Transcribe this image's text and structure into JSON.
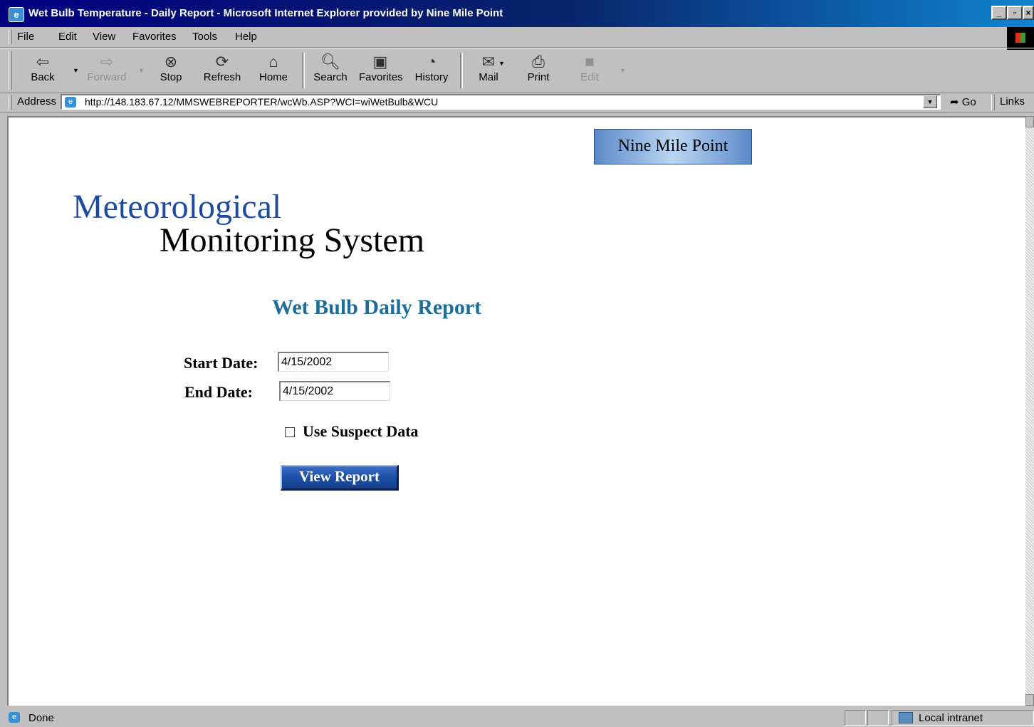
{
  "window": {
    "title": "Wet Bulb Temperature - Daily Report - Microsoft Internet Explorer provided by Nine Mile Point"
  },
  "menu": [
    "File",
    "Edit",
    "View",
    "Favorites",
    "Tools",
    "Help"
  ],
  "toolbar": {
    "back": "Back",
    "forward": "Forward",
    "stop": "Stop",
    "refresh": "Refresh",
    "home": "Home",
    "search": "Search",
    "favorites": "Favorites",
    "history": "History",
    "mail": "Mail",
    "print": "Print",
    "edit": "Edit"
  },
  "address": {
    "label": "Address",
    "url": "http://148.183.67.12/MMSWEBREPORTER/wcWb.ASP?WCI=wiWetBulb&WCU",
    "go": "Go",
    "links": "Links"
  },
  "page": {
    "site_button": "Nine Mile Point",
    "logo_line1": "Meteorological",
    "logo_line2": "Monitoring System",
    "report_title": "Wet Bulb Daily Report",
    "start_label": "Start Date:",
    "start_value": "4/15/2002",
    "end_label": "End Date:",
    "end_value": "4/15/2002",
    "suspect_label": "Use Suspect Data",
    "suspect_checked": false,
    "view_button": "View Report"
  },
  "status": {
    "text": "Done",
    "zone": "Local intranet"
  },
  "colors": {
    "title_bar": "#000080",
    "logo_blue": "#1c4aa0",
    "report_title": "#1c6e9a",
    "button_blue": "#1d4fa6"
  }
}
